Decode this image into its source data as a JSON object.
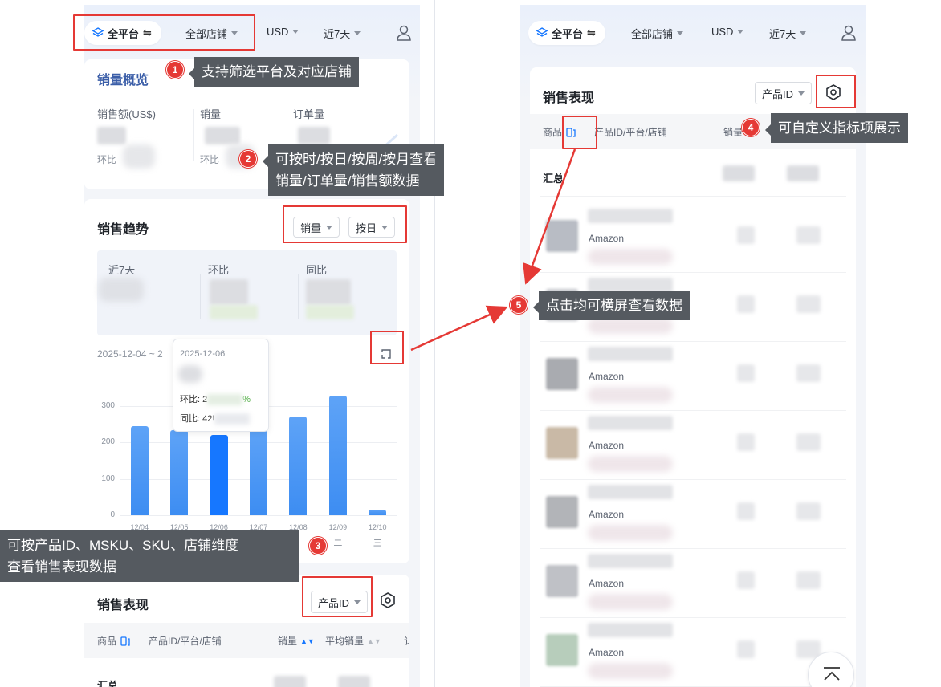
{
  "filters": {
    "platform": "全平台",
    "platform_swap": "⇋",
    "store": "全部店铺",
    "currency": "USD",
    "period": "近7天"
  },
  "overview": {
    "title": "销量概览",
    "metrics": [
      {
        "label": "销售额(US$)"
      },
      {
        "label": "销量"
      },
      {
        "label": "订单量"
      }
    ],
    "compare_label": "环比"
  },
  "trend": {
    "title": "销售趋势",
    "metric_select": "销量",
    "granularity_select": "按日",
    "summary_labels": [
      "近7天",
      "环比",
      "同比"
    ],
    "date_range": "2025-12-04 ~ 2",
    "tooltip": {
      "date": "2025-12-06",
      "huanbi_prefix": "环比: 2",
      "huanbi_suffix": "%",
      "tongbi_prefix": "同比: 42!"
    }
  },
  "chart_data": {
    "type": "bar",
    "categories": [
      "12/04",
      "12/05",
      "12/06",
      "12/07",
      "12/08",
      "12/09",
      "12/10"
    ],
    "weekdays": [
      "",
      "",
      "",
      "",
      "",
      "二",
      "三"
    ],
    "values": [
      245,
      235,
      220,
      240,
      272,
      330,
      15
    ],
    "highlight_index": 2,
    "yticks": [
      0,
      100,
      200,
      300
    ],
    "ylim": [
      0,
      340
    ],
    "title": "",
    "xlabel": "",
    "ylabel": ""
  },
  "performance": {
    "title": "销售表现",
    "dimension_select": "产品ID",
    "columns": {
      "product": "商品",
      "product_id": "产品ID/平台/店铺",
      "sales": "销量",
      "avg_sales": "平均销量",
      "trailing": "讠"
    },
    "sum_label": "汇总",
    "platform_name": "Amazon",
    "right_sales_col": "销量"
  },
  "annotations": [
    {
      "num": "1",
      "text": "支持筛选平台及对应店铺"
    },
    {
      "num": "2",
      "text": "可按时/按日/按周/按月查看\n销量/订单量/销售额数据"
    },
    {
      "num": "3",
      "text": "可按产品ID、MSKU、SKU、店铺维度\n查看销售表现数据"
    },
    {
      "num": "4",
      "text": "可自定义指标项展示"
    },
    {
      "num": "5",
      "text": "点击均可横屏查看数据"
    }
  ],
  "colors": {
    "accent": "#1677ff",
    "annotation_red": "#e53935",
    "note_bg": "#555a60"
  }
}
